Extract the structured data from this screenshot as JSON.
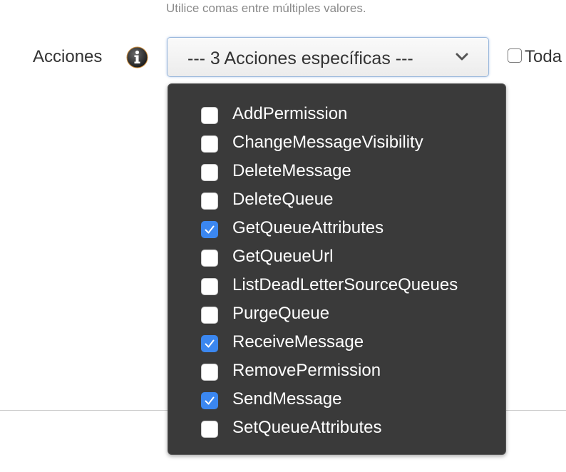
{
  "hint_text": "Utilice comas entre múltiples valores.",
  "actions_label": "Acciones",
  "select": {
    "value": "--- 3 Acciones específicas ---"
  },
  "all_checkbox": {
    "label": "Toda",
    "checked": false
  },
  "options": [
    {
      "label": "AddPermission",
      "checked": false
    },
    {
      "label": "ChangeMessageVisibility",
      "checked": false
    },
    {
      "label": "DeleteMessage",
      "checked": false
    },
    {
      "label": "DeleteQueue",
      "checked": false
    },
    {
      "label": "GetQueueAttributes",
      "checked": true
    },
    {
      "label": "GetQueueUrl",
      "checked": false
    },
    {
      "label": "ListDeadLetterSourceQueues",
      "checked": false
    },
    {
      "label": "PurgeQueue",
      "checked": false
    },
    {
      "label": "ReceiveMessage",
      "checked": true
    },
    {
      "label": "RemovePermission",
      "checked": false
    },
    {
      "label": "SendMessage",
      "checked": true
    },
    {
      "label": "SetQueueAttributes",
      "checked": false
    }
  ],
  "colors": {
    "dropdown_bg": "#3a3a3a",
    "checked_accent": "#3b87f0"
  }
}
